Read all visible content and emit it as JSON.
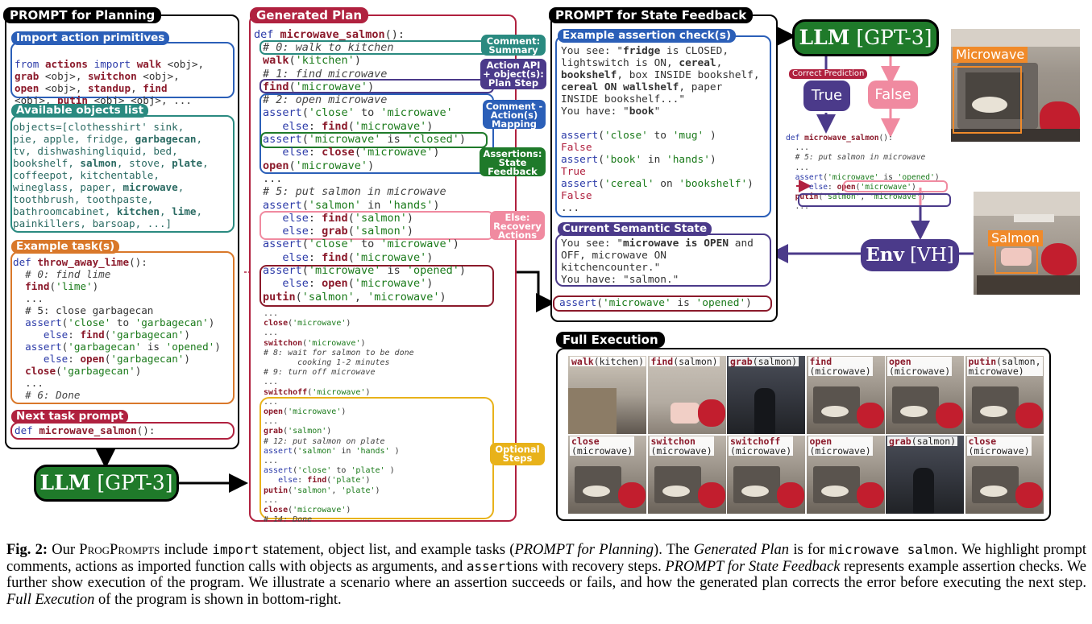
{
  "planning": {
    "title": "PROMPT for Planning",
    "import_title": "Import action primitives",
    "import_code": [
      "from actions import walk <obj>,",
      "grab <obj>, switchon <obj>,",
      "open <obj>, standup, find",
      "<obj>, putin <obj> <obj>, ..."
    ],
    "objects_title": "Available objects list",
    "objects_code": [
      "objects=[clothesshirt' sink,",
      "pie, apple, fridge, garbagecan,",
      "tv, dishwashingliquid, bed,",
      "bookshelf, salmon, stove, plate,",
      "coffeepot, kitchentable,",
      "wineglass, paper, microwave,",
      "toothbrush, toothpaste,",
      "bathroomcabinet, kitchen, lime,",
      "painkillers, barsoap, ...]"
    ],
    "example_title": "Example task(s)",
    "example_code": [
      "def throw_away_lime():",
      "  # 0: find lime",
      "  find('lime')",
      "  ...",
      "  # 5: close garbagecan",
      "  assert('close' to 'garbagecan')",
      "     else: find('garbagecan')",
      "  assert('garbagecan' is 'opened')",
      "     else: open('garbagecan')",
      "  close('garbagecan')",
      "  ...",
      "  # 6: Done"
    ],
    "next_title": "Next task prompt",
    "next_code": "def microwave_salmon():",
    "llm_bold": "LLM",
    "llm_rest": " [GPT-3]"
  },
  "plan": {
    "title": "Generated Plan",
    "header": "def microwave_salmon():",
    "lines": [
      " # 0: walk to kitchen",
      " walk('kitchen')",
      " # 1: find microwave",
      " find('microwave')",
      " # 2: open microwave",
      " assert('close' to 'microwave')",
      "    else: find('microwave')",
      " assert('microwave' is 'closed')",
      "    else: close('microwave')",
      " open('microwave')",
      " ...",
      " # 5: put salmon in microwave",
      " assert('salmon' in 'hands')",
      "    else: find('salmon')",
      "    else: grab('salmon')",
      " assert('close' to 'microwave')",
      "    else: find('microwave')",
      " assert('microwave' is 'opened')",
      "    else: open('microwave')",
      " putin('salmon', 'microwave')"
    ],
    "small_lines": [
      "...",
      "close('microwave')",
      "...",
      "switchon('microwave')",
      "# 8: wait for salmon to be done",
      "       cooking 1-2 minutes",
      "# 9: turn off microwave",
      "...",
      "switchoff('microwave')",
      "...",
      "open('microwave')",
      "...",
      "grab('salmon')",
      "# 12: put salmon on plate",
      "assert('salmon' in 'hands' )",
      "...",
      "assert('close' to 'plate' )",
      "   else: find('plate')",
      "putin('salmon', 'plate')",
      "...",
      "close('microwave')",
      "# 14: Done"
    ],
    "tags": {
      "comment_summary": "Comment: Summary",
      "action_api": "Action API + object(s): Plan Step",
      "comment_action": "Comment - Action(s) Mapping",
      "assertions": "Assertions: State Feedback",
      "else_recovery": "Else: Recovery Actions",
      "optional": "Optional Steps"
    }
  },
  "state": {
    "title": "PROMPT for State Feedback",
    "example_title": "Example assertion check(s)",
    "example_text": [
      "You see: \"fridge is CLOSED,",
      "lightswitch is ON, cereal,",
      "bookshelf, box INSIDE bookshelf,",
      "cereal ON wallshelf, paper",
      "INSIDE bookshelf...\"",
      "You have: \"book\"",
      "",
      "assert('close' to 'mug' )",
      "False",
      "assert('book' in 'hands')",
      "True",
      "assert('cereal' on 'bookshelf')",
      "False",
      "..."
    ],
    "semantic_title": "Current Semantic State",
    "semantic_text": [
      "You see: \"microwave is OPEN and",
      "OFF, microwave ON",
      "kitchencounter.\"",
      "You have: \"salmon.\""
    ],
    "query": "assert('microwave' is 'opened')"
  },
  "feedback": {
    "llm_bold": "LLM",
    "llm_rest": " [GPT-3]",
    "correct_prediction": "Correct Prediction",
    "true_label": "True",
    "false_label": "False",
    "env_bold": "Env",
    "env_rest": " [VH]",
    "microwave_label": "Microwave",
    "salmon_label": "Salmon",
    "mini_code": [
      "def microwave_salmon():",
      "  ...",
      "  # 5: put salmon in microwave",
      "  ...",
      "  assert('microwave' is 'opened')",
      "     else: open('microwave')",
      "  putin('salmon', 'microwave')",
      "  ..."
    ]
  },
  "execution": {
    "title": "Full Execution",
    "cells": [
      {
        "fn": "walk",
        "arg": "(kitchen)"
      },
      {
        "fn": "find",
        "arg": "(salmon)"
      },
      {
        "fn": "grab",
        "arg": "(salmon)"
      },
      {
        "fn": "find",
        "arg": "\n(microwave)"
      },
      {
        "fn": "open",
        "arg": "\n(microwave)"
      },
      {
        "fn": "putin",
        "arg": "(salmon,\nmicrowave)"
      },
      {
        "fn": "close",
        "arg": "\n(microwave)"
      },
      {
        "fn": "switchon",
        "arg": "\n(microwave)"
      },
      {
        "fn": "switchoff",
        "arg": "\n(microwave)"
      },
      {
        "fn": "open",
        "arg": "\n(microwave)"
      },
      {
        "fn": "grab",
        "arg": "(salmon)"
      },
      {
        "fn": "close",
        "arg": "\n(microwave)"
      }
    ]
  },
  "caption": {
    "fig": "Fig. 2:",
    "t1": " Our ",
    "progprompt": "ProgPrompts",
    "t2": " include ",
    "c_import": "import",
    "t3": " statement, object list, and example tasks (",
    "i_planning": "PROMPT for Planning",
    "t4": "). The ",
    "i_generated": "Generated Plan",
    "t5": " is for ",
    "c_microwave": "microwave salmon",
    "t6": ". We highlight prompt comments, actions as imported function calls with objects as arguments, and ",
    "c_assert": "assert",
    "t7": "ions with recovery steps. ",
    "i_state": "PROMPT for State Feedback",
    "t8": " represents example assertion checks. We further show execution of the program. We illustrate a scenario where an assertion succeeds or fails, and how the generated plan corrects the error before executing the next step. ",
    "i_full": "Full Execution",
    "t9": " of the program is shown in bottom-right."
  },
  "colors": {
    "blue": "#2b5fb8",
    "teal": "#2a8a80",
    "orange": "#d9782a",
    "crimson": "#b0213f",
    "purple": "#4b3a8a",
    "green": "#1f7a2a",
    "pink": "#f08aa0",
    "gold": "#e8b21a"
  }
}
